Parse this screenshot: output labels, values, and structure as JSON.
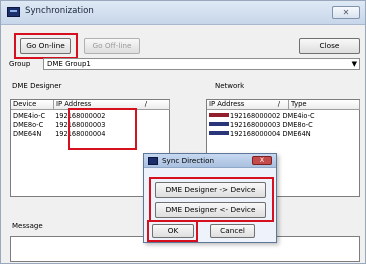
{
  "window": {
    "title": "Synchronization",
    "close_glyph": "✕",
    "app_icon": "dme-app-icon"
  },
  "toolbar": {
    "go_online": "Go On-line",
    "go_offline": "Go Off-line",
    "close": "Close"
  },
  "group": {
    "label": "Group",
    "selected": "DME Group1",
    "dropdown_icon": "chevron-down-icon"
  },
  "designer": {
    "title": "DME Designer",
    "columns": [
      "Device",
      "IP Address"
    ],
    "sort_marker": "/",
    "rows": [
      {
        "device": "DME4io-C",
        "ip": "192168000002"
      },
      {
        "device": "DME8o-C",
        "ip": "192168000003"
      },
      {
        "device": "DME64N",
        "ip": "192168000004"
      }
    ]
  },
  "network": {
    "title": "Network",
    "columns": [
      "IP Address",
      "Type"
    ],
    "sort_marker": "/",
    "rows": [
      {
        "ip": "192168000002",
        "type": "DME4io-C",
        "color": "#931e2d"
      },
      {
        "ip": "192168000003",
        "type": "DME8o-C",
        "color": "#2b3579"
      },
      {
        "ip": "192168000004",
        "type": "DME64N",
        "color": "#2b3579"
      }
    ]
  },
  "message": {
    "label": "Message"
  },
  "dialog": {
    "title": "Sync Direction",
    "close_glyph": "X",
    "to_device": "DME Designer -> Device",
    "from_device": "DME Designer <- Device",
    "ok": "OK",
    "cancel": "Cancel"
  },
  "colors": {
    "highlight_red": "#d6101e"
  }
}
